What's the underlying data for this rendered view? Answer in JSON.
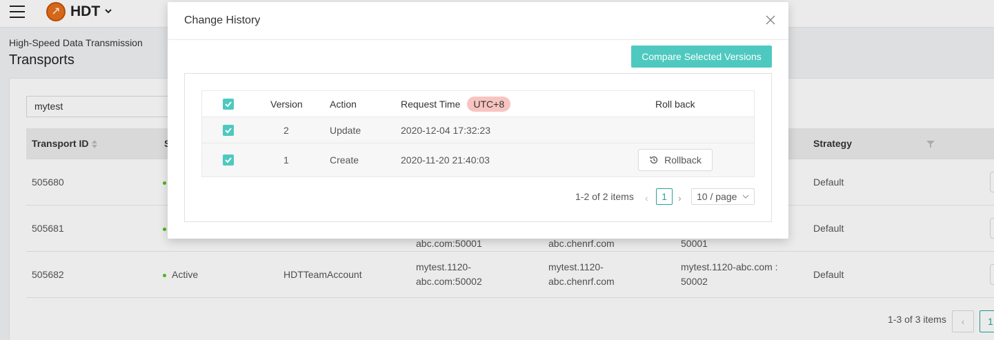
{
  "app": {
    "name": "HDT",
    "logo_icon": "rocket-logo-icon",
    "breadcrumb": "High-Speed Data Transmission",
    "page_title": "Transports"
  },
  "search": {
    "value": "mytest"
  },
  "transport_table": {
    "headers": {
      "transport_id": "Transport ID",
      "status_partial": "S",
      "strategy": "Strategy"
    },
    "rows": [
      {
        "id": "505680",
        "status": "",
        "account": "",
        "domain_a": "",
        "domain_b": "",
        "endpoint": "",
        "strategy": "Default"
      },
      {
        "id": "505681",
        "status": "",
        "account": "",
        "domain_a": "abc.com:50001",
        "domain_b": "abc.chenrf.com",
        "endpoint": "50001",
        "strategy": "Default"
      },
      {
        "id": "505682",
        "status": "Active",
        "account": "HDTTeamAccount",
        "domain_a": "mytest.1120-abc.com:50002",
        "domain_a_line1": "mytest.1120-",
        "domain_a_line2": "abc.com:50002",
        "domain_b_line1": "mytest.1120-",
        "domain_b_line2": "abc.chenrf.com",
        "endpoint_line1": "mytest.1120-abc.com :",
        "endpoint_line2": "50002",
        "strategy": "Default"
      }
    ],
    "pagination": {
      "summary": "1-3 of 3 items",
      "current_page": "1"
    }
  },
  "modal": {
    "title": "Change History",
    "compare_button": "Compare Selected Versions",
    "columns": {
      "version": "Version",
      "action": "Action",
      "request_time": "Request Time",
      "timezone_badge": "UTC+8",
      "roll_back": "Roll back"
    },
    "rows": [
      {
        "checked": true,
        "version": "2",
        "action": "Update",
        "request_time": "2020-12-04 17:32:23",
        "rollback": ""
      },
      {
        "checked": true,
        "version": "1",
        "action": "Create",
        "request_time": "2020-11-20 21:40:03",
        "rollback": "Rollback"
      }
    ],
    "pagination": {
      "summary": "1-2 of 2 items",
      "current_page": "1",
      "page_size": "10 / page"
    }
  },
  "colors": {
    "accent": "#4ec9bf",
    "link": "#27a39a",
    "badge_bg": "#f8c4c0",
    "status_active": "#52c41a"
  }
}
